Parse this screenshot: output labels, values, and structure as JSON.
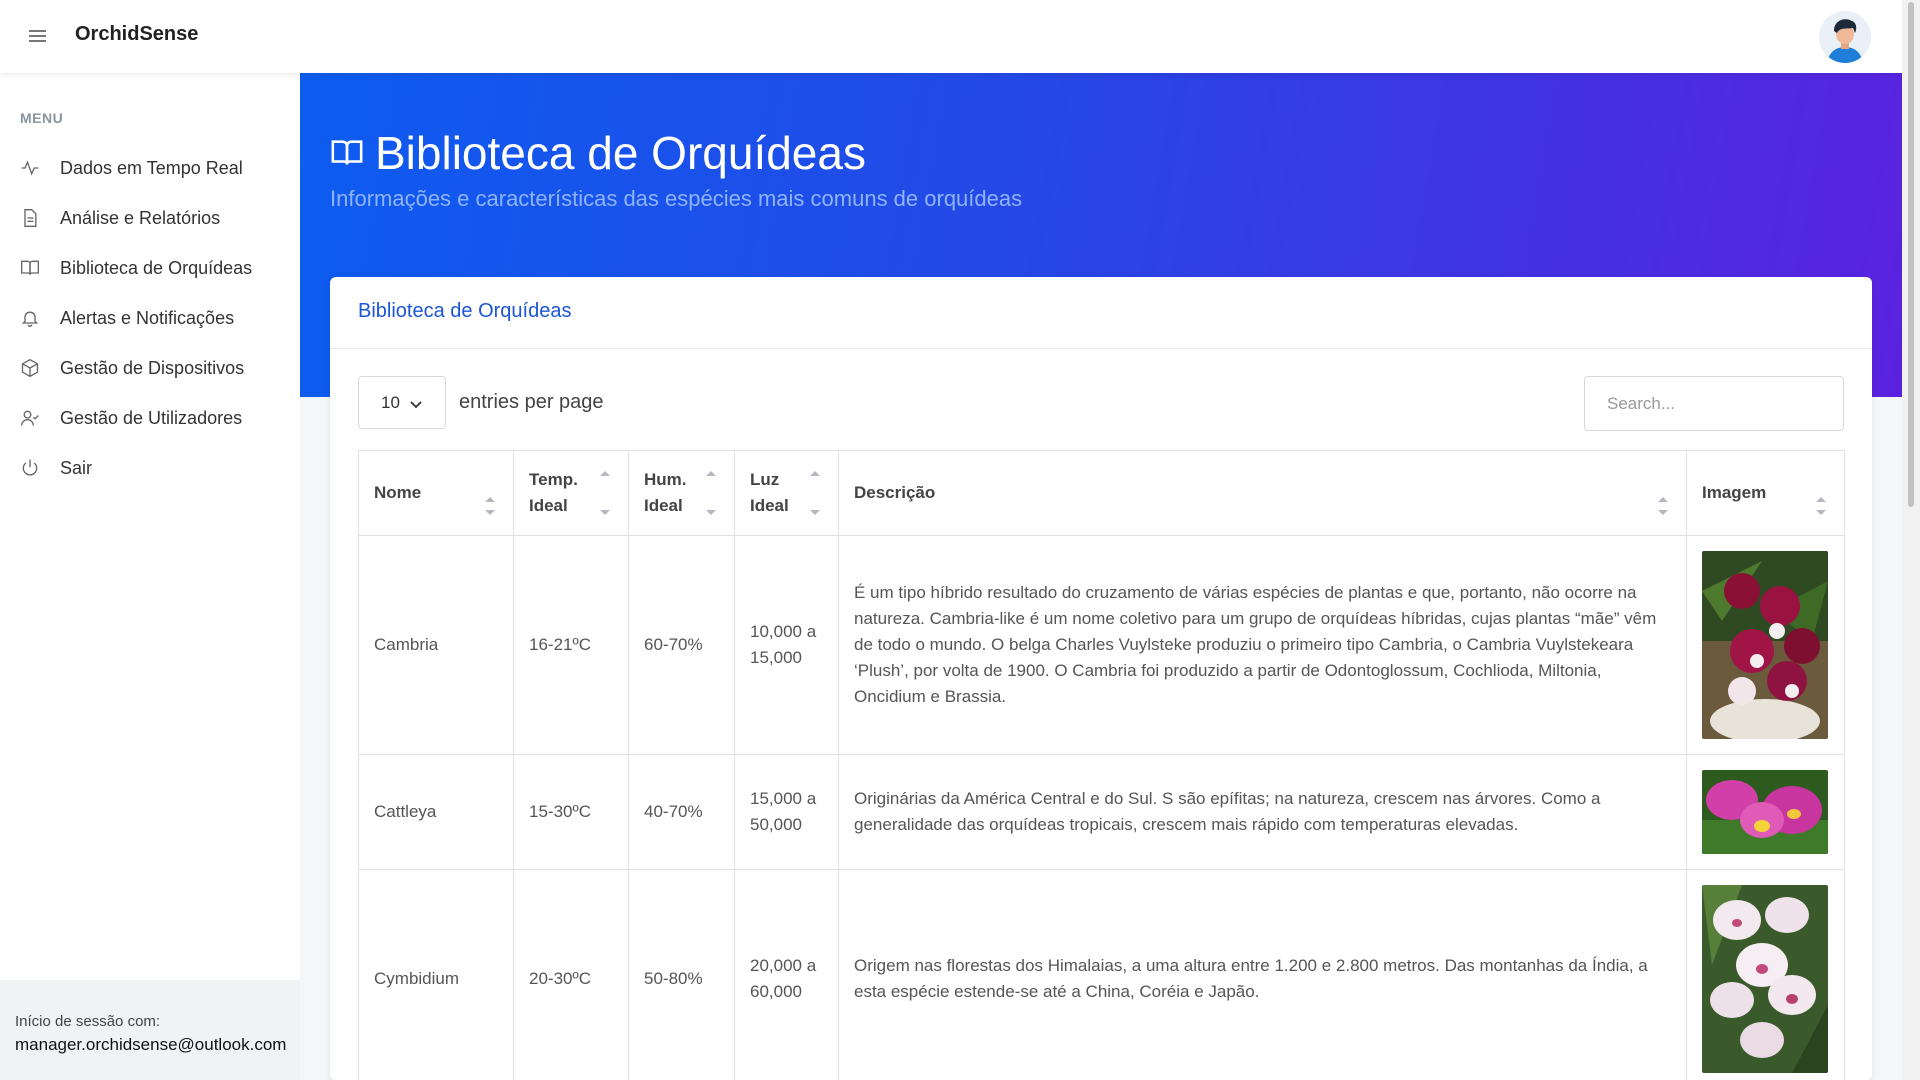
{
  "app": {
    "title": "OrchidSense"
  },
  "sidebar": {
    "menu_title": "MENU",
    "items": [
      {
        "label": "Dados em Tempo Real",
        "icon": "activity-icon"
      },
      {
        "label": "Análise e Relatórios",
        "icon": "document-icon"
      },
      {
        "label": "Biblioteca de Orquídeas",
        "icon": "book-icon"
      },
      {
        "label": "Alertas e Notificações",
        "icon": "bell-icon"
      },
      {
        "label": "Gestão de Dispositivos",
        "icon": "box-icon"
      },
      {
        "label": "Gestão de Utilizadores",
        "icon": "user-check-icon"
      },
      {
        "label": "Sair",
        "icon": "power-icon"
      }
    ],
    "session_label": "Início de sessão com:",
    "session_email": "manager.orchidsense@outlook.com"
  },
  "hero": {
    "title": "Biblioteca de Orquídeas",
    "subtitle": "Informações e características das espécies mais comuns de orquídeas"
  },
  "card": {
    "title": "Biblioteca de Orquídeas",
    "entries_value": "10",
    "entries_label": "entries per page",
    "search_placeholder": "Search..."
  },
  "table": {
    "headers": [
      {
        "line1": "Nome",
        "line2": ""
      },
      {
        "line1": "Temp.",
        "line2": "Ideal"
      },
      {
        "line1": "Hum.",
        "line2": "Ideal"
      },
      {
        "line1": "Luz",
        "line2": "Ideal"
      },
      {
        "line1": "Descrição",
        "line2": ""
      },
      {
        "line1": "Imagem",
        "line2": ""
      }
    ],
    "rows": [
      {
        "nome": "Cambria",
        "temp": "16-21ºC",
        "hum": "60-70%",
        "luz": "10,000 a 15,000",
        "descricao": "É um tipo híbrido resultado do cruzamento de várias espécies de plantas e que, portanto, não ocorre na natureza. Cambria-like é um nome coletivo para um grupo de orquídeas híbridas, cujas plantas “mãe” vêm de todo o mundo. O belga Charles Vuylsteke produziu o primeiro tipo Cambria, o Cambria Vuylstekeara ‘Plush’, por volta de 1900. O Cambria foi produzido a partir de Odontoglossum, Cochlioda, Miltonia, Oncidium e Brassia.",
        "image": "cambria-orchid-photo"
      },
      {
        "nome": "Cattleya",
        "temp": "15-30ºC",
        "hum": "40-70%",
        "luz": "15,000 a 50,000",
        "descricao": "Originárias da América Central e do Sul. S são epífitas; na natureza, crescem nas árvores. Como a generalidade das orquídeas tropicais, crescem mais rápido com temperaturas elevadas.",
        "image": "cattleya-orchid-photo"
      },
      {
        "nome": "Cymbidium",
        "temp": "20-30ºC",
        "hum": "50-80%",
        "luz": "20,000 a 60,000",
        "descricao": "Origem nas florestas dos Himalaias, a uma altura entre 1.200 e 2.800 metros. Das montanhas da Índia, a esta espécie estende-se até a China, Coréia e Japão.",
        "image": "cymbidium-orchid-photo"
      }
    ]
  },
  "colors": {
    "accent": "#1a56d6",
    "hero_start": "#0d5cf0",
    "hero_end": "#5a22e0"
  }
}
